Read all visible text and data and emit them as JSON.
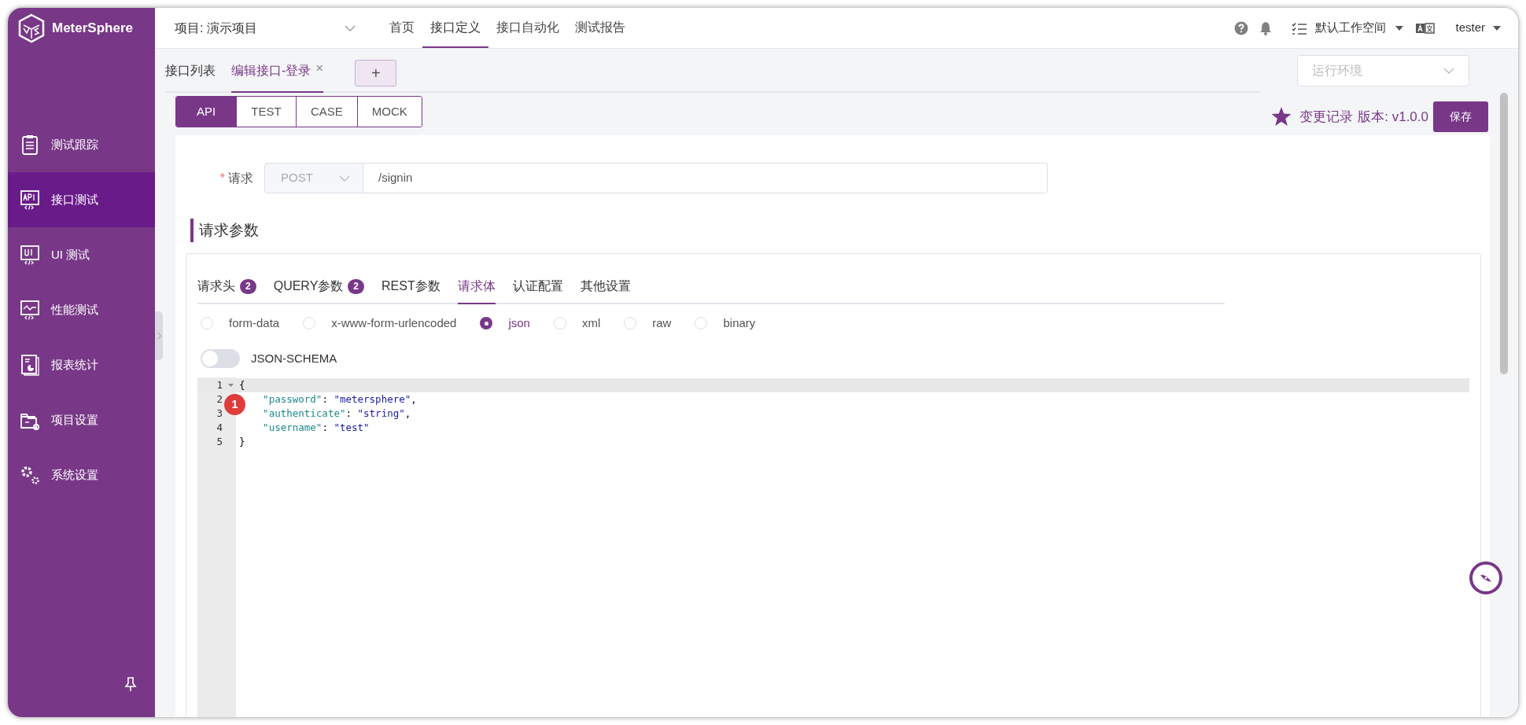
{
  "app": {
    "name": "MeterSphere"
  },
  "sidebar": {
    "items": [
      {
        "label": "测试跟踪",
        "selected": false
      },
      {
        "label": "接口测试",
        "selected": true
      },
      {
        "label": "UI 测试",
        "selected": false
      },
      {
        "label": "性能测试",
        "selected": false
      },
      {
        "label": "报表统计",
        "selected": false
      },
      {
        "label": "项目设置",
        "selected": false
      },
      {
        "label": "系统设置",
        "selected": false
      }
    ]
  },
  "header": {
    "project": "项目: 演示项目",
    "nav": [
      {
        "label": "首页",
        "selected": false
      },
      {
        "label": "接口定义",
        "selected": true
      },
      {
        "label": "接口自动化",
        "selected": false
      },
      {
        "label": "测试报告",
        "selected": false
      }
    ],
    "workspace": "默认工作空间",
    "user": "tester"
  },
  "tabs": [
    {
      "label": "接口列表",
      "selected": false
    },
    {
      "label": "编辑接口-登录",
      "selected": true,
      "close": "×"
    }
  ],
  "add_tab": "+",
  "environment": {
    "placeholder": "运行环境"
  },
  "mode_tabs": [
    {
      "label": "API",
      "selected": true
    },
    {
      "label": "TEST",
      "selected": false
    },
    {
      "label": "CASE",
      "selected": false
    },
    {
      "label": "MOCK",
      "selected": false
    }
  ],
  "history": "变更记录",
  "version": "版本: v1.0.0",
  "save": "保存",
  "request": {
    "label": "请求",
    "required": "*",
    "method": "POST",
    "url": "/signin"
  },
  "params_title": "请求参数",
  "param_tabs": [
    {
      "label": "请求头",
      "count": "2",
      "selected": false
    },
    {
      "label": "QUERY参数",
      "count": "2",
      "selected": false
    },
    {
      "label": "REST参数",
      "selected": false
    },
    {
      "label": "请求体",
      "selected": true
    },
    {
      "label": "认证配置",
      "selected": false
    },
    {
      "label": "其他设置",
      "selected": false
    }
  ],
  "body_types": [
    {
      "label": "form-data",
      "selected": false
    },
    {
      "label": "x-www-form-urlencoded",
      "selected": false
    },
    {
      "label": "json",
      "selected": true
    },
    {
      "label": "xml",
      "selected": false
    },
    {
      "label": "raw",
      "selected": false
    },
    {
      "label": "binary",
      "selected": false
    }
  ],
  "json_schema": {
    "label": "JSON-SCHEMA",
    "on": false
  },
  "editor": {
    "lines": [
      {
        "number": "1",
        "text": "{",
        "foldable": true,
        "active": true
      },
      {
        "number": "2",
        "text": "    \"password\": \"metersphere\",",
        "foldable": false,
        "active": false,
        "marker": "1"
      },
      {
        "number": "3",
        "text": "    \"authenticate\": \"string\",",
        "foldable": false,
        "active": false
      },
      {
        "number": "4",
        "text": "    \"username\": \"test\"",
        "foldable": false,
        "active": false
      },
      {
        "number": "5",
        "text": "}",
        "foldable": false,
        "active": false
      }
    ]
  }
}
